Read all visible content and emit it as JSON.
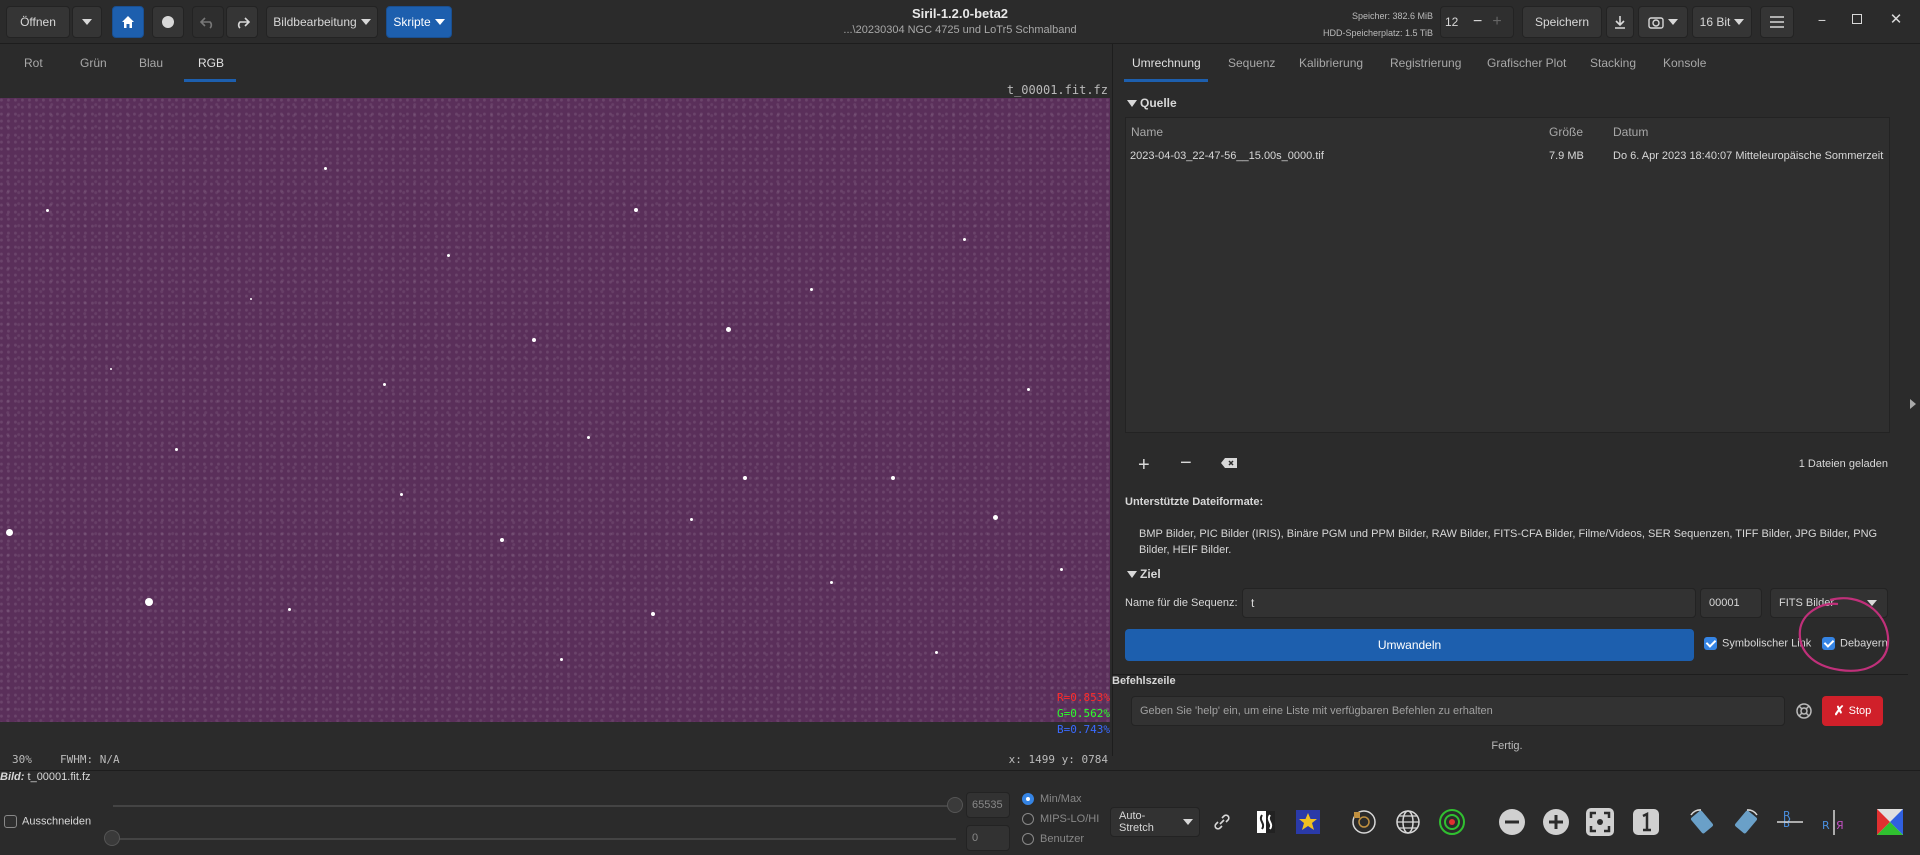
{
  "header": {
    "open_label": "Öffnen",
    "image_processing_label": "Bildbearbeitung",
    "scripts_label": "Skripte",
    "title": "Siril-1.2.0-beta2",
    "path": "...\\20230304 NGC 4725 und LoTr5 Schmalband",
    "memory": "Speicher: 382.6 MiB",
    "disk": "HDD-Speicherplatz: 1.5 TiB",
    "thread_count": "12",
    "save_label": "Speichern",
    "bit_depth": "16 Bit"
  },
  "left_tabs": [
    "Rot",
    "Grün",
    "Blau",
    "RGB"
  ],
  "image": {
    "file_name": "t_00001.fit.fz",
    "r_value": "R=0.853%",
    "g_value": "G=0.562%",
    "b_value": "B=0.743%",
    "zoom": "30%",
    "fwhm": "FWHM: N/A",
    "coords": "x: 1499  y: 0784"
  },
  "right_tabs": [
    "Umrechnung",
    "Sequenz",
    "Kalibrierung",
    "Registrierung",
    "Grafischer Plot",
    "Stacking",
    "Konsole"
  ],
  "source": {
    "title": "Quelle",
    "col_name": "Name",
    "col_size": "Größe",
    "col_date": "Datum",
    "file": {
      "name": "2023-04-03_22-47-56__15.00s_0000.tif",
      "size": "7.9 MB",
      "date": "Do  6. Apr 2023 18:40:07 Mitteleuropäische Sommerzeit"
    },
    "files_loaded": "1 Dateien geladen"
  },
  "formats": {
    "title": "Unterstützte Dateiformate:",
    "text": "BMP Bilder, PIC Bilder (IRIS), Binäre PGM und PPM Bilder, RAW Bilder, FITS-CFA Bilder, Filme/Videos, SER Sequenzen, TIFF Bilder, JPG Bilder, PNG Bilder, HEIF Bilder."
  },
  "target": {
    "title": "Ziel",
    "seq_label": "Name für die Sequenz:",
    "seq_value": "t",
    "start_index": "00001",
    "output_type": "FITS Bilder",
    "convert_label": "Umwandeln",
    "symlink_label": "Symbolischer Link",
    "debayer_label": "Debayern"
  },
  "command": {
    "title": "Befehlszeile",
    "placeholder": "Geben Sie 'help' ein, um eine Liste mit verfügbaren Befehlen zu erhalten",
    "stop_label": "Stop",
    "status": "Fertig."
  },
  "bottom": {
    "image_label": "Bild:",
    "image_file": "t_00001.fit.fz",
    "crop_label": "Ausschneiden",
    "max_value": "65535",
    "min_value": "0",
    "radio_minmax": "Min/Max",
    "radio_mips": "MIPS-LO/HI",
    "radio_user": "Benutzer",
    "stretch_mode": "Auto-Stretch"
  },
  "colors": {
    "accent": "#1d5fae",
    "stop": "#d0202a",
    "image_bg": "#5a2f5a",
    "annotation": "#c0307a"
  }
}
